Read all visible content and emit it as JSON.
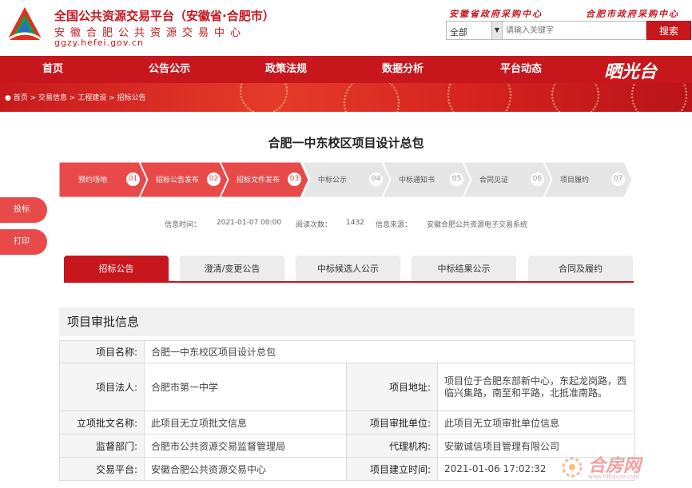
{
  "header": {
    "title": "全国公共资源交易平台（安徽省·合肥市）",
    "subtitle": "安徽合肥公共资源交易中心",
    "domain": "ggzy.hefei.gov.cn",
    "link_province": "安徽省政府采购中心",
    "link_city": "合肥市政府采购中心",
    "search": {
      "select_value": "全部",
      "placeholder": "请输入关键字",
      "button": "搜索"
    }
  },
  "nav": {
    "items": [
      "首页",
      "公告公示",
      "政策法规",
      "数据分析",
      "平台动态"
    ],
    "brand": "晒光台"
  },
  "breadcrumb": "首页 > 交易信息 > 工程建设 > 招标公告",
  "page_title": "合肥一中东校区项目设计总包",
  "steps": [
    {
      "label": "预约场地",
      "num": "01",
      "done": true
    },
    {
      "label": "招标公告发布",
      "num": "02",
      "done": true
    },
    {
      "label": "招标文件发布",
      "num": "03",
      "done": true
    },
    {
      "label": "中标公示",
      "num": "04",
      "done": false
    },
    {
      "label": "中标通知书",
      "num": "05",
      "done": false
    },
    {
      "label": "合同见证",
      "num": "06",
      "done": false
    },
    {
      "label": "项目履约",
      "num": "07",
      "done": false
    }
  ],
  "info": {
    "time_label": "信息时间：",
    "time": "2021-01-07 00:00",
    "views_label": "阅读次数：",
    "views": "1432",
    "source_label": "信息来源：",
    "source": "安徽合肥公共资源电子交易系统"
  },
  "side": {
    "bid": "投标",
    "print": "打印"
  },
  "tabs": [
    "招标公告",
    "澄清/变更公告",
    "中标候选人公示",
    "中标结果公示",
    "合同及履约"
  ],
  "section_title": "项目审批信息",
  "table": {
    "r1": {
      "l1": "项目名称:",
      "v1": "合肥一中东校区项目设计总包"
    },
    "r2": {
      "l1": "项目法人:",
      "v1": "合肥市第一中学",
      "l2": "项目地址:",
      "v2": "项目位于合肥东部新中心，东起龙岗路，西临兴集路，南至和平路，北抵准南路。"
    },
    "r3": {
      "l1": "立项批文名称:",
      "v1": "此项目无立项批文信息",
      "l2": "项目审批单位:",
      "v2": "此项目无立项审批单位信息"
    },
    "r4": {
      "l1": "监督部门:",
      "v1": "合肥市公共资源交易监督管理局",
      "l2": "代理机构:",
      "v2": "安徽诚信项目管理有限公司"
    },
    "r5": {
      "l1": "交易平台:",
      "v1": "安徽合肥公共资源交易中心",
      "l2": "项目建立时间:",
      "v2": "2021-01-06 17:02:32"
    }
  },
  "watermark": {
    "text": "合房网",
    "url": "www.hfhouse.com"
  },
  "colors": {
    "primary": "#c8161d",
    "step_done": "#e84a4a",
    "step_todo": "#e6e6e6"
  }
}
